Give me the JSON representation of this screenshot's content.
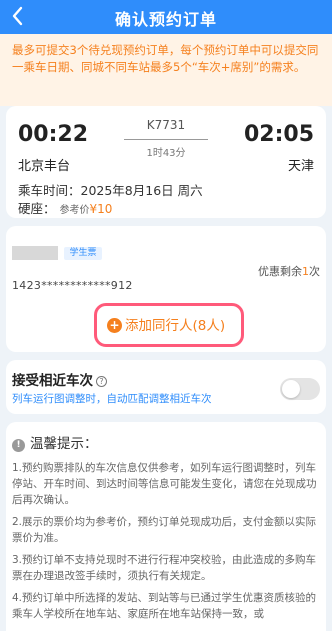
{
  "header": {
    "title": "确认预约订单",
    "back_icon": "chevron-left-icon"
  },
  "notice": {
    "text": "最多可提交3个待兑现预约订单，每个预约订单中可以提交同一乘车日期、同城不同车站最多5个“车次+席别”的需求。"
  },
  "trip": {
    "depart_time": "00:22",
    "arrive_time": "02:05",
    "train_no": "K7731",
    "duration": "1时43分",
    "from_station": "北京丰台",
    "to_station": "天津",
    "date_text": "乘车时间：2025年8月16日 周六",
    "seat_label": "硬座：",
    "ref_price_label": "参考价",
    "price": "¥10"
  },
  "passenger": {
    "type_badge": "学生票",
    "id_number": "1423************912",
    "remain_prefix": "优惠剩余",
    "remain_count": "1",
    "remain_suffix": "次"
  },
  "add_companion": {
    "plus": "+",
    "label": "添加同行人(8人)"
  },
  "nearby": {
    "label": "接受相近车次",
    "help": "?",
    "desc": "列车运行图调整时，自动匹配调整相近车次",
    "enabled": false
  },
  "tips": {
    "title": "温馨提示：",
    "info": "!",
    "items": [
      "1.预约购票排队的车次信息仅供参考，如列车运行图调整时，列车停站、开车时间、到达时间等信息可能发生变化，请您在兑现成功后再次确认。",
      "2.展示的票价均为参考价，预约订单兑现成功后，支付金额以实际票价为准。",
      "3.预约订单不支持兑现时不进行行程冲突校验，由此造成的多购车票在办理退改签手续时，须执行有关规定。",
      "4.预约订单中所选择的发站、到站等与已通过学生优惠资质核验的乘车人学校所在地车站、家庭所在地车站保持一致，或"
    ]
  },
  "colors": {
    "primary": "#2f8dfb",
    "accent": "#f5801e",
    "highlight": "#ff5a7a"
  }
}
